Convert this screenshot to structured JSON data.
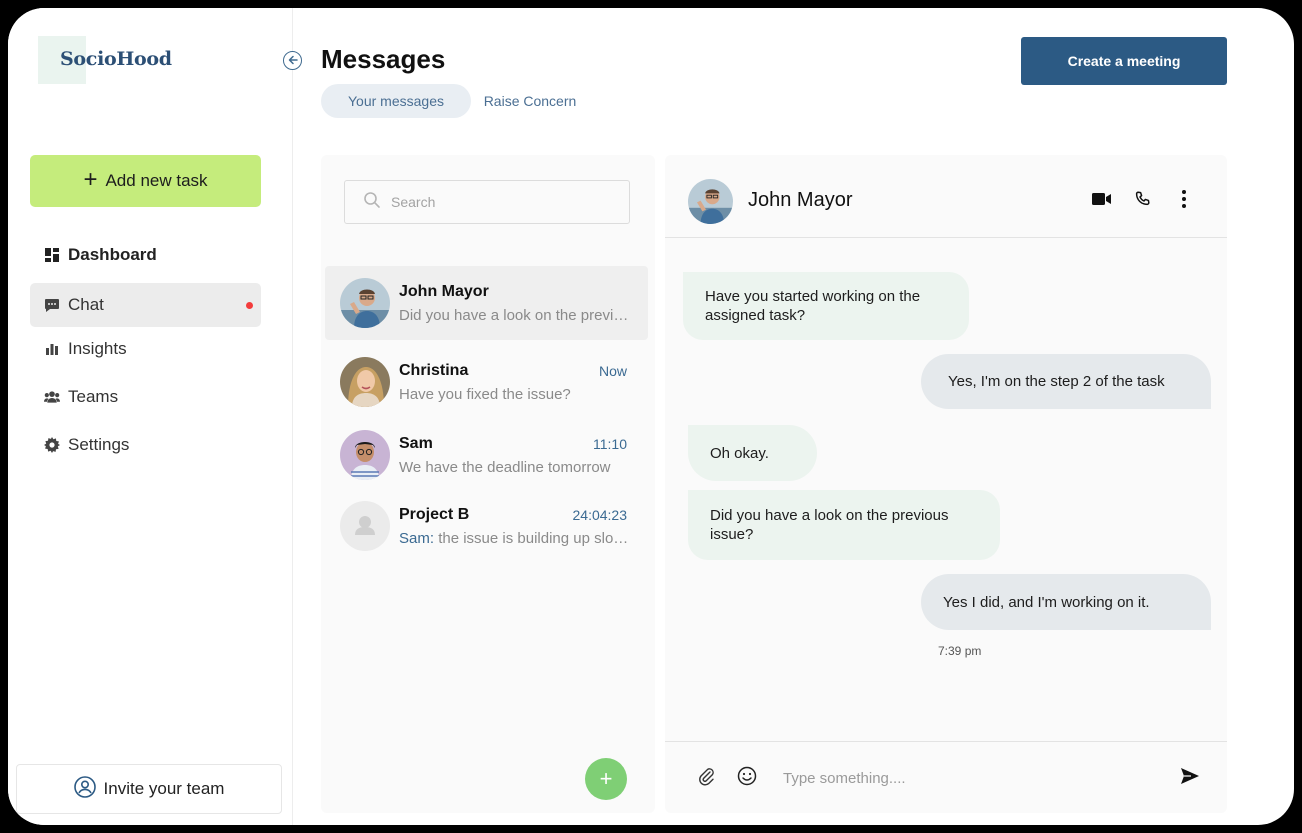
{
  "app": {
    "brand": "SocioHood"
  },
  "sidebar": {
    "add_task_label": "Add new task",
    "items": [
      {
        "label": "Dashboard",
        "icon": "dashboard-icon"
      },
      {
        "label": "Chat",
        "icon": "chat-icon",
        "active": true,
        "notification": true
      },
      {
        "label": "Insights",
        "icon": "bar-chart-icon"
      },
      {
        "label": "Teams",
        "icon": "people-icon"
      },
      {
        "label": "Settings",
        "icon": "gear-icon"
      }
    ],
    "invite_label": "Invite your team"
  },
  "header": {
    "title": "Messages",
    "tabs": [
      {
        "label": "Your messages",
        "active": true
      },
      {
        "label": "Raise Concern",
        "active": false
      }
    ],
    "create_meeting_label": "Create a meeting"
  },
  "conversations": {
    "search_placeholder": "Search",
    "items": [
      {
        "name": "John Mayor",
        "time": "",
        "preview": "Did you have a look on the previous issue?",
        "active": true
      },
      {
        "name": "Christina",
        "time": "Now",
        "preview": "Have you fixed the issue?"
      },
      {
        "name": "Sam",
        "time": "11:10",
        "preview": "We have the deadline tomorrow"
      },
      {
        "name": "Project B",
        "time": "24:04:23",
        "sender": "Sam:",
        "preview": "the issue is building up slowly"
      }
    ]
  },
  "chat": {
    "contact_name": "John Mayor",
    "messages": [
      {
        "direction": "in",
        "text": "Have you started working on the assigned task?"
      },
      {
        "direction": "out",
        "text": "Yes, I'm on the step 2 of the task"
      },
      {
        "direction": "in",
        "text": "Oh okay."
      },
      {
        "direction": "in",
        "text": "Did you have a look on the previous issue?"
      },
      {
        "direction": "out",
        "text": "Yes I did, and I'm working on it."
      }
    ],
    "last_message_time": "7:39 pm",
    "composer_placeholder": "Type something...."
  },
  "colors": {
    "brand": "#2c4f75",
    "accent_green": "#c5ec7c",
    "primary_button": "#2c5a84",
    "fab": "#7fcf75",
    "notification_dot": "#f33c3c",
    "incoming_bubble": "#ecf4ef",
    "outgoing_bubble": "#e5e9ec"
  }
}
